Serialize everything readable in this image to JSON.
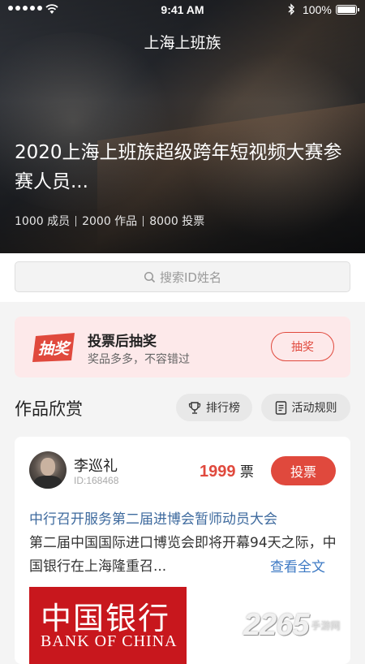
{
  "status_bar": {
    "time": "9:41 AM",
    "battery": "100%"
  },
  "header": {
    "app_title": "上海上班族"
  },
  "contest": {
    "title": "2020上海上班族超级跨年短视频大赛参赛人员...",
    "stats": [
      "1000 成员",
      "2000 作品",
      "8000 投票"
    ]
  },
  "search": {
    "placeholder": "搜索ID姓名"
  },
  "promo": {
    "badge_text": "抽奖",
    "title": "投票后抽奖",
    "subtitle": "奖品多多，不容错过",
    "button_label": "抽奖"
  },
  "section": {
    "title": "作品欣赏",
    "ranking_label": "排行榜",
    "rules_label": "活动规则"
  },
  "entry": {
    "name": "李巡礼",
    "id": "ID:168468",
    "votes": "1999",
    "votes_unit": "票",
    "vote_button": "投票",
    "post_title": "中行召开服务第二届进博会暂师动员大会",
    "post_excerpt": "第二届中国国际进口博览会即将开幕94天之际，中国银行在上海隆重召...",
    "read_more": "查看全文",
    "image_text_cn": "中国银行",
    "image_text_en": "BANK OF CHINA"
  },
  "watermark": {
    "brand": "2265",
    "suffix": "手游网"
  },
  "colors": {
    "accent": "#e0493d",
    "link": "#3e7ac4",
    "promo_bg": "#fde9ea"
  }
}
